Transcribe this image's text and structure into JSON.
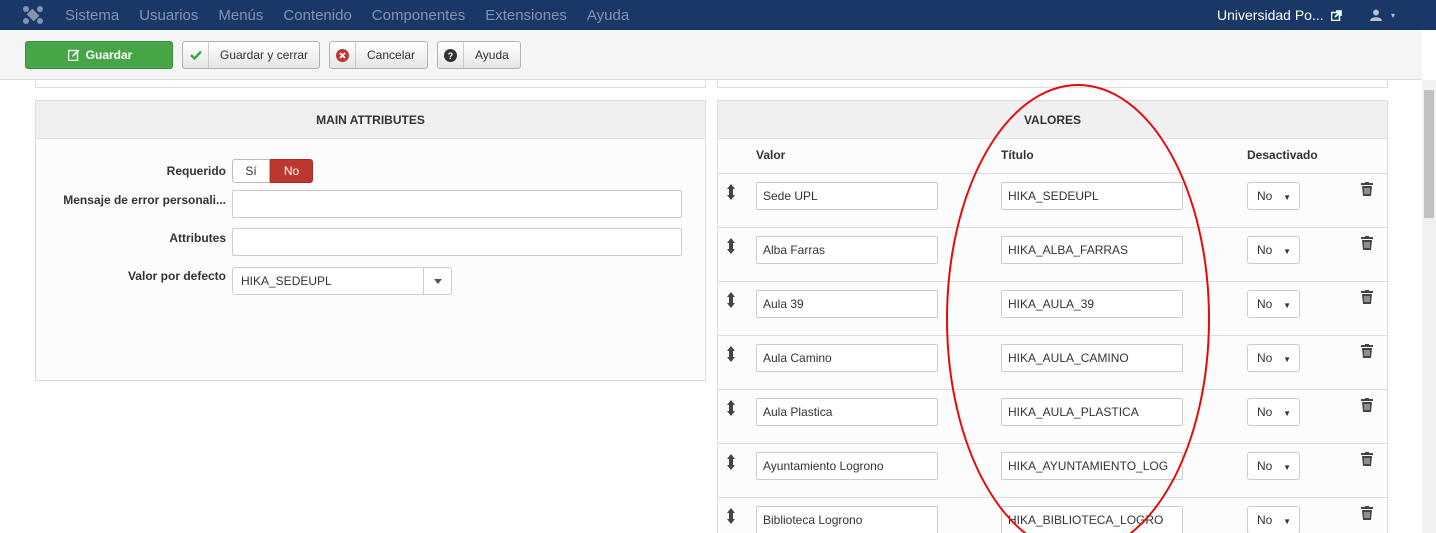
{
  "navbar": {
    "menu": [
      "Sistema",
      "Usuarios",
      "Menús",
      "Contenido",
      "Componentes",
      "Extensiones",
      "Ayuda"
    ],
    "site_name": "Universidad Po...",
    "logo_icon": "joomla-logo-icon",
    "user_icon": "user-icon"
  },
  "toolbar": {
    "save_label": "Guardar",
    "save_close_label": "Guardar y cerrar",
    "cancel_label": "Cancelar",
    "help_label": "Ayuda"
  },
  "main_attributes": {
    "title": "MAIN ATTRIBUTES",
    "required_label": "Requerido",
    "required_yes": "Sí",
    "required_no": "No",
    "error_message_label": "Mensaje de error personali...",
    "error_message_value": "",
    "attributes_label": "Attributes",
    "attributes_value": "",
    "default_label": "Valor por defecto",
    "default_value": "HIKA_SEDEUPL"
  },
  "valores": {
    "title": "VALORES",
    "col_valor": "Valor",
    "col_titulo": "Título",
    "col_desactivado": "Desactivado",
    "rows": [
      {
        "valor": "Sede UPL",
        "titulo": "HIKA_SEDEUPL",
        "desactivado": "No"
      },
      {
        "valor": "Alba Farras",
        "titulo": "HIKA_ALBA_FARRAS",
        "desactivado": "No"
      },
      {
        "valor": "Aula 39",
        "titulo": "HIKA_AULA_39",
        "desactivado": "No"
      },
      {
        "valor": "Aula Camino",
        "titulo": "HIKA_AULA_CAMINO",
        "desactivado": "No"
      },
      {
        "valor": "Aula Plastica",
        "titulo": "HIKA_AULA_PLASTICA",
        "desactivado": "No"
      },
      {
        "valor": "Ayuntamiento Logrono",
        "titulo": "HIKA_AYUNTAMIENTO_LOG",
        "desactivado": "No"
      },
      {
        "valor": "Biblioteca Logrono",
        "titulo": "HIKA_BIBLIOTECA_LOGRO",
        "desactivado": "No"
      }
    ]
  },
  "colors": {
    "navbar": "#1a3867",
    "save_button": "#46a546",
    "toggle_no": "#bd362f",
    "annotation": "#e8080a"
  }
}
